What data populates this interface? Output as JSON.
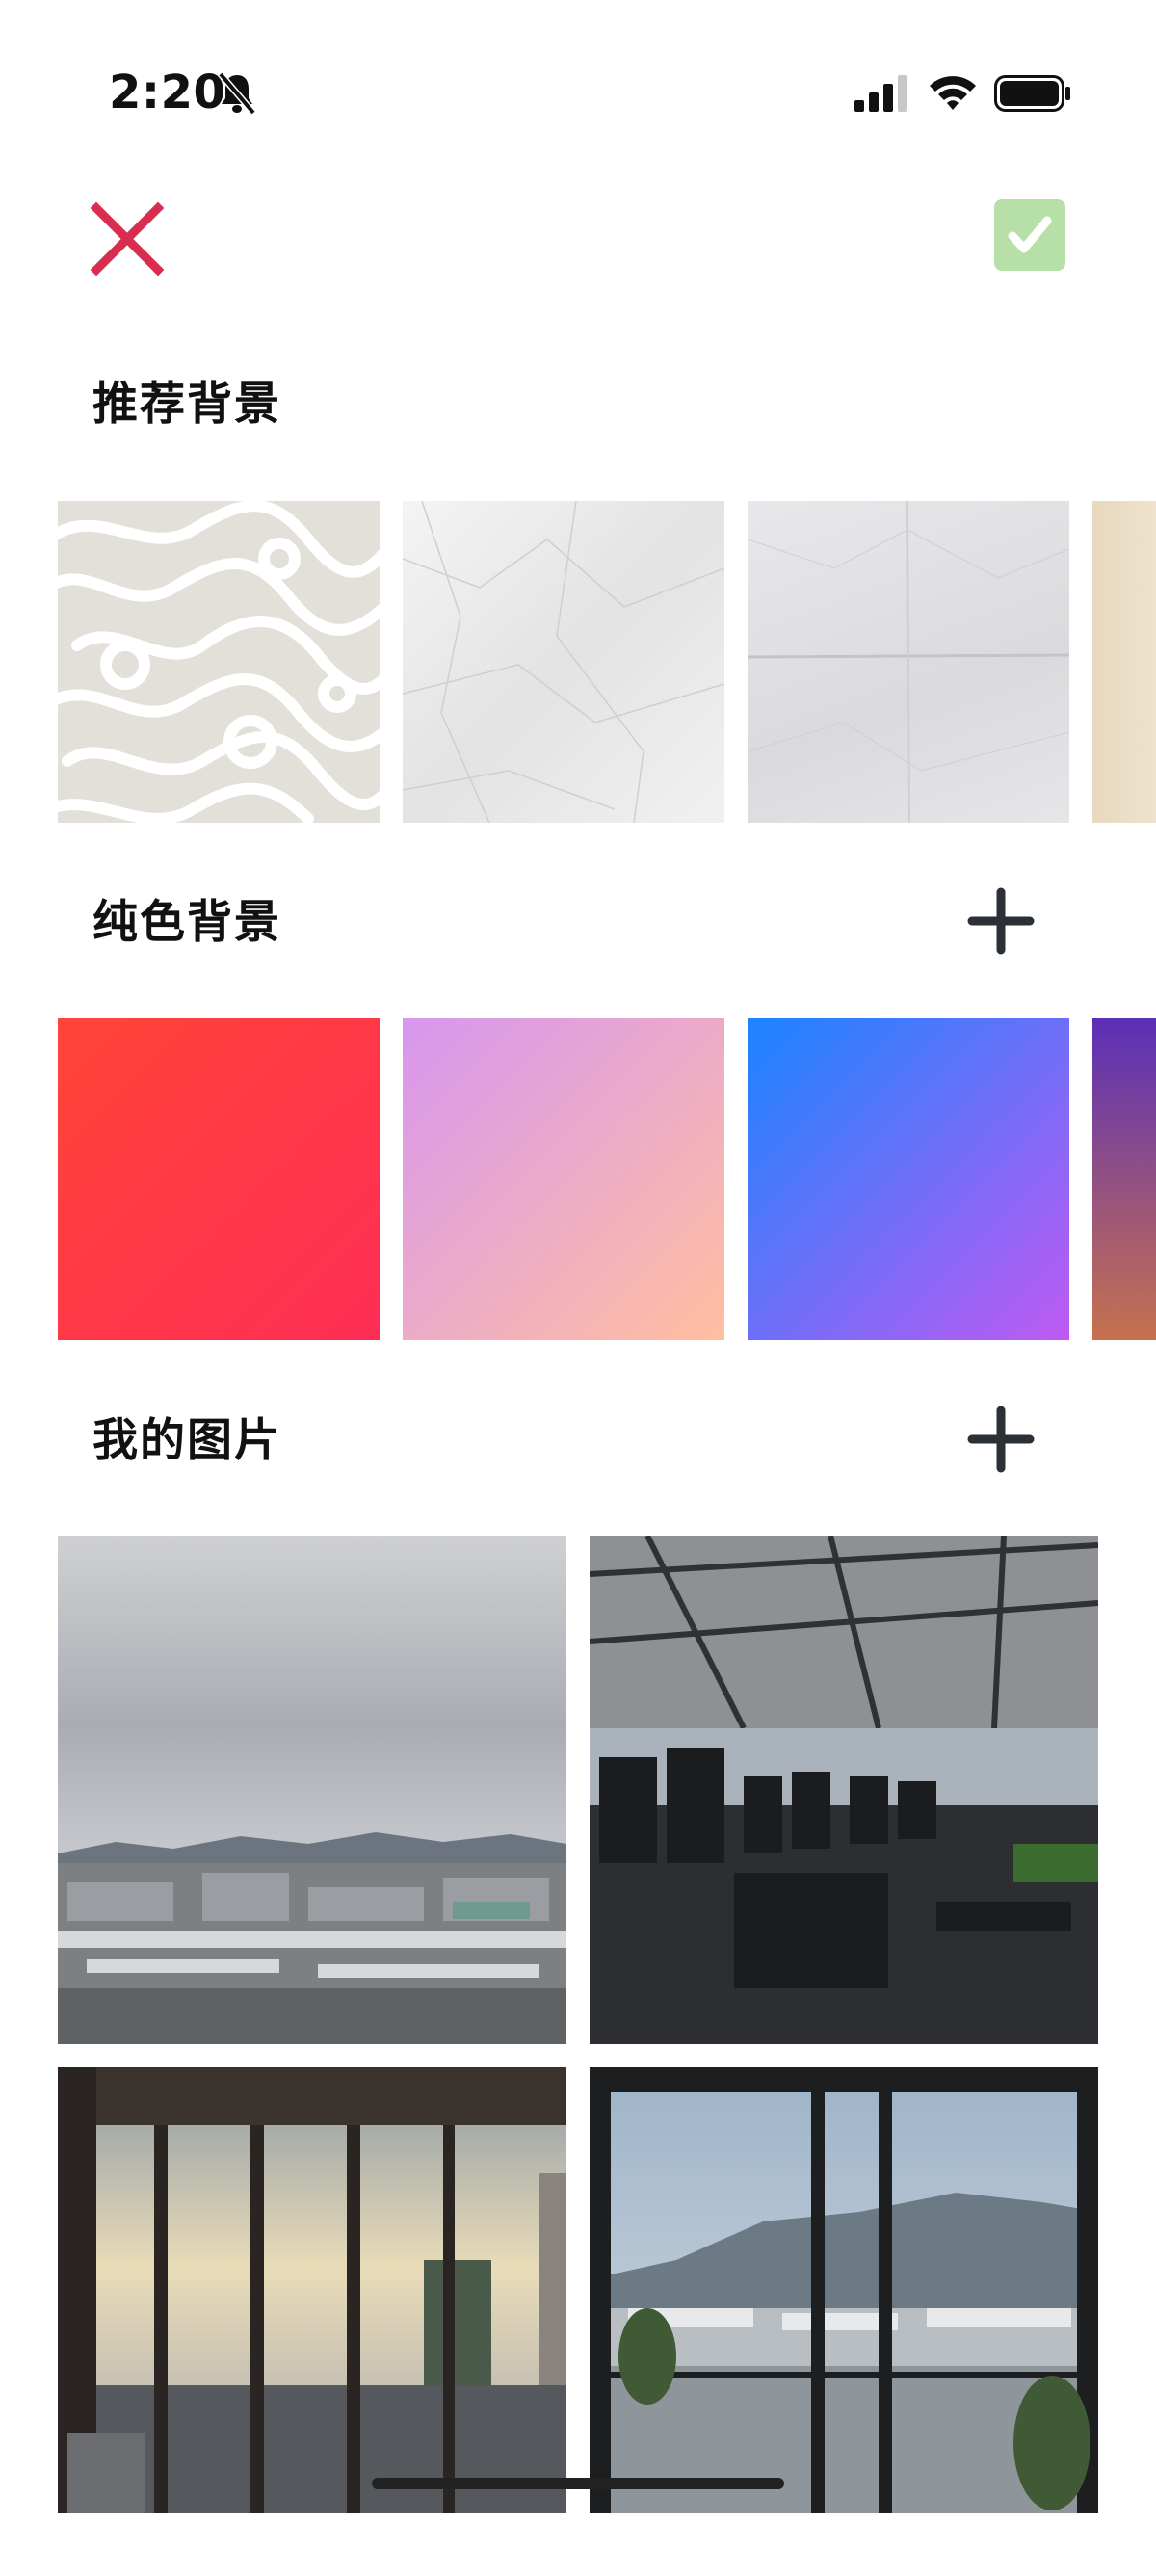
{
  "status_bar": {
    "time": "2:20",
    "icons": [
      "bell-slash-icon",
      "cellular-signal-icon",
      "wifi-icon",
      "battery-icon"
    ]
  },
  "toolbar": {
    "close_icon": "close-icon",
    "confirm_icon": "checkmark-icon",
    "close_color": "#d92d4f",
    "confirm_color": "#b7e0a8"
  },
  "sections": {
    "recommended": {
      "title": "推荐背景"
    },
    "solid": {
      "title": "纯色背景",
      "add_icon": "plus-icon"
    },
    "my_images": {
      "title": "我的图片",
      "add_icon": "plus-icon"
    }
  },
  "recommended_backgrounds": [
    {
      "kind": "swirl-pattern",
      "colors": [
        "#e6e3de",
        "#ffffff"
      ]
    },
    {
      "kind": "crumpled-paper",
      "colors": [
        "#e9e9e9",
        "#f5f5f5"
      ]
    },
    {
      "kind": "folded-paper",
      "colors": [
        "#dddcdf",
        "#ebeaed"
      ]
    },
    {
      "kind": "vintage-paper",
      "colors": [
        "#efe3cf",
        "#f7efe0"
      ]
    }
  ],
  "solid_backgrounds": [
    {
      "from": "#ff4438",
      "to": "#ff2d55"
    },
    {
      "from": "#d896ef",
      "to": "#ffbfa0"
    },
    {
      "from": "#1a84ff",
      "to": "#bf5af2"
    },
    {
      "from": "#5b2fb8",
      "to": "#c7714e"
    }
  ],
  "my_images": [
    {
      "scene": "cloudy-city-rooftops"
    },
    {
      "scene": "gym-equipment"
    },
    {
      "scene": "gym-window-sunset"
    },
    {
      "scene": "window-city-view"
    }
  ]
}
